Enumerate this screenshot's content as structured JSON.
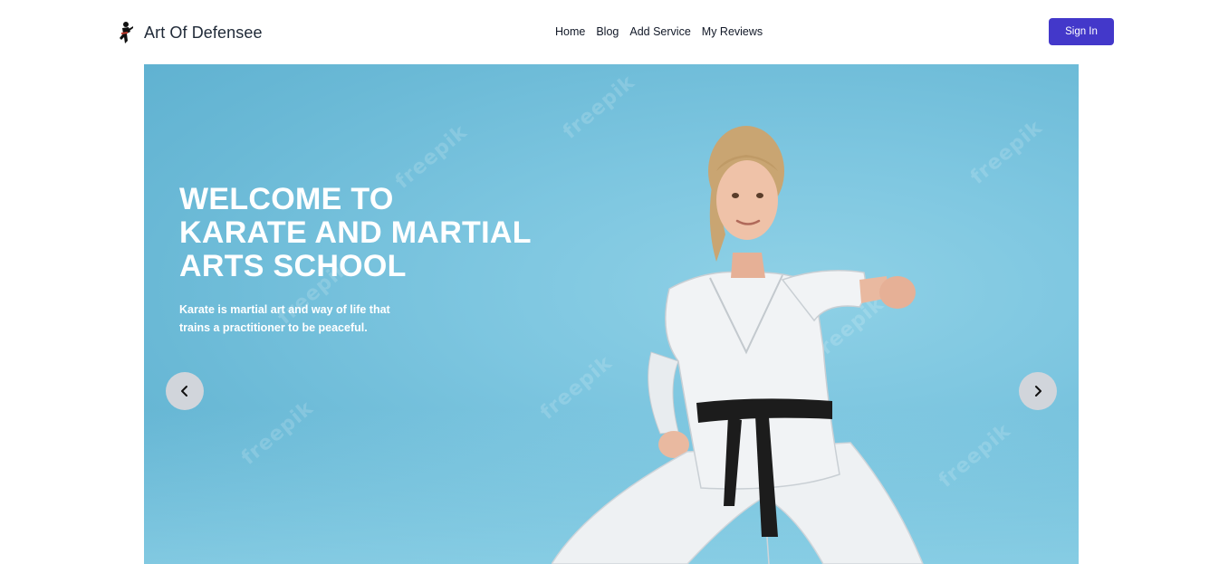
{
  "brand": {
    "name": "Art Of Defensee",
    "logo_icon": "karate-fighter-icon"
  },
  "nav": {
    "items": [
      {
        "label": "Home"
      },
      {
        "label": "Blog"
      },
      {
        "label": "Add Service"
      },
      {
        "label": "My Reviews"
      }
    ],
    "signin_label": "Sign In"
  },
  "hero": {
    "title_lines": [
      "WELCOME TO",
      "KARATE AND MARTIAL",
      "ARTS SCHOOL"
    ],
    "subtitle": "Karate is martial art and way of life that trains a practitioner to be peaceful.",
    "watermark": "freepik",
    "prev_icon": "chevron-left-icon",
    "next_icon": "chevron-right-icon"
  },
  "colors": {
    "accent": "#4338ca",
    "hero_bg": "#7dc6e0",
    "carousel_btn": "#d1d5db"
  }
}
